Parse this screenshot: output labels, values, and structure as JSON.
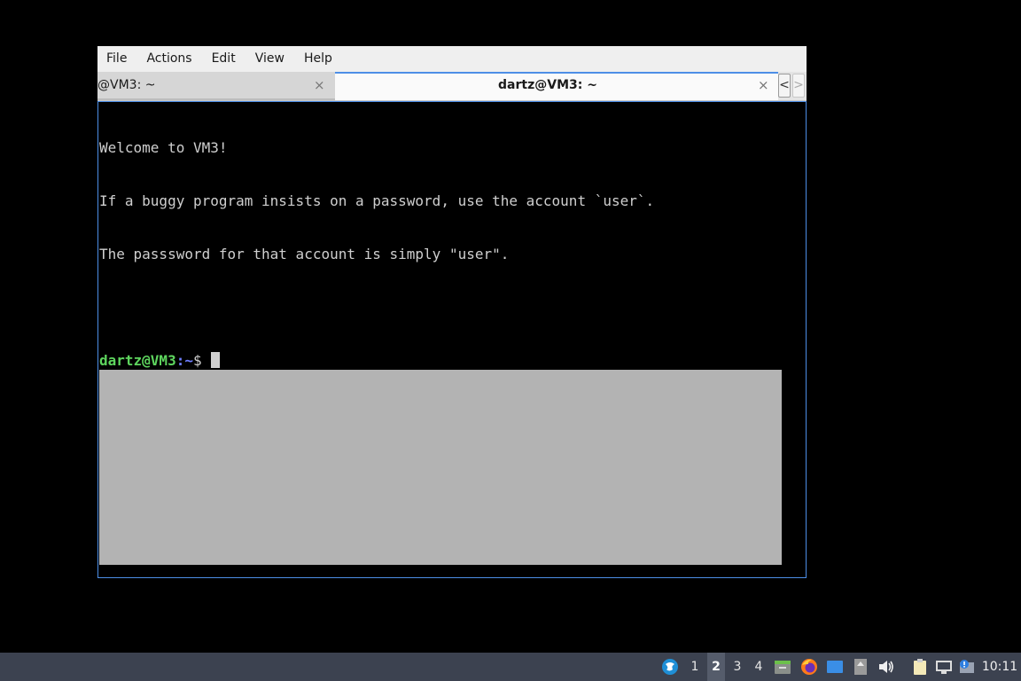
{
  "menu": {
    "items": [
      "File",
      "Actions",
      "Edit",
      "View",
      "Help"
    ]
  },
  "tabs": {
    "inactive_label": "@VM3: ~",
    "active_label": "dartz@VM3: ~",
    "close_glyph": "×",
    "scroll_left_glyph": "<",
    "scroll_right_glyph": ">"
  },
  "terminal": {
    "lines": [
      "Welcome to VM3!",
      "If a buggy program insists on a password, use the account `user`.",
      "The passsword for that account is simply \"user\".",
      ""
    ],
    "prompt_user": "dartz@VM3",
    "prompt_path": ":~",
    "prompt_symbol": "$",
    "colors": {
      "prompt_user": "#5ed55e",
      "prompt_path": "#6f7fff",
      "text": "#cfcfcf",
      "background": "#000000"
    }
  },
  "taskbar": {
    "workspaces": [
      "1",
      "2",
      "3",
      "4"
    ],
    "active_workspace": "2",
    "icons": [
      "lxqt-menu-icon",
      "file-manager-icon",
      "firefox-icon",
      "desktop-icon",
      "removable-media-icon",
      "volume-icon",
      "clipboard-icon",
      "network-icon",
      "update-notifier-icon"
    ],
    "clock": "10:11"
  },
  "accent_color": "#4d8ee6"
}
